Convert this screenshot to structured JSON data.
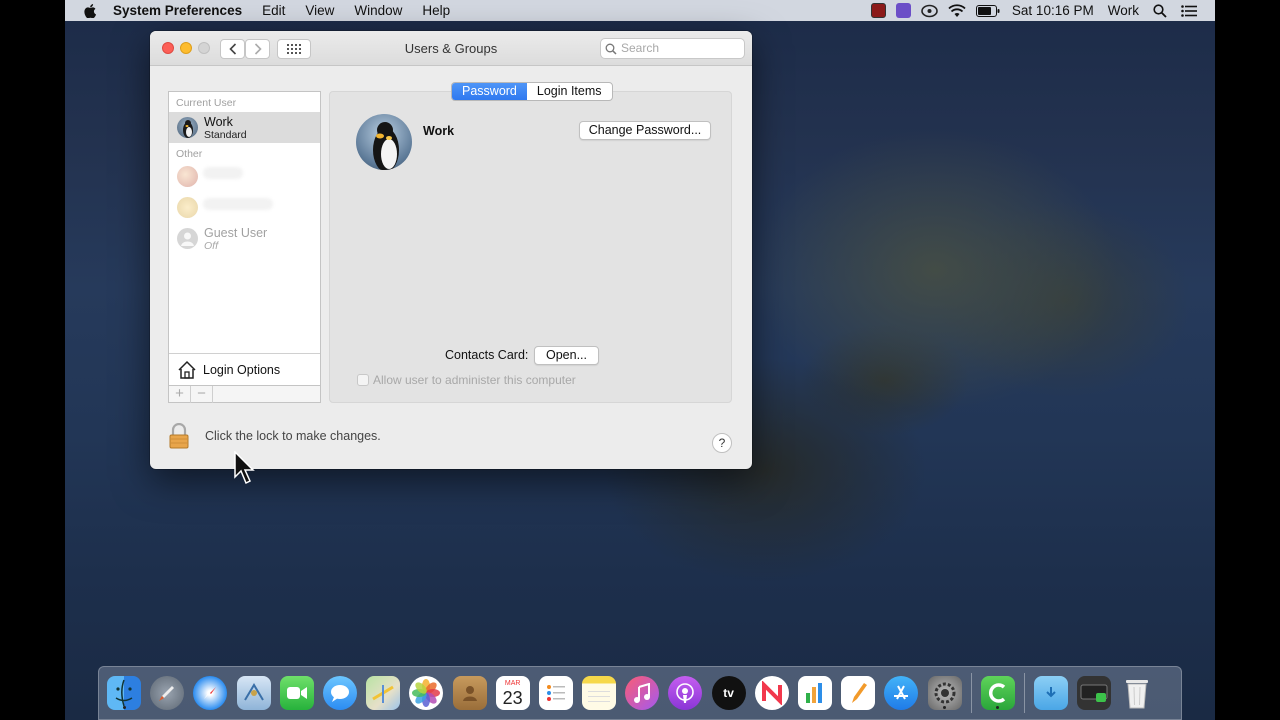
{
  "menubar": {
    "app_name": "System Preferences",
    "items": [
      "Edit",
      "View",
      "Window",
      "Help"
    ],
    "clock": "Sat 10:16 PM",
    "user": "Work"
  },
  "window": {
    "title": "Users & Groups",
    "search_placeholder": "Search"
  },
  "sidebar": {
    "current_user_heading": "Current User",
    "current_user": {
      "name": "Work",
      "role": "Standard"
    },
    "other_heading": "Other",
    "guest": {
      "name": "Guest User",
      "status": "Off"
    },
    "login_options": "Login Options",
    "add_symbol": "+",
    "remove_symbol": "−"
  },
  "tabs": [
    {
      "label": "Password",
      "active": true
    },
    {
      "label": "Login Items",
      "active": false
    }
  ],
  "user_panel": {
    "name": "Work",
    "change_password_label": "Change Password...",
    "contacts_card_label": "Contacts Card:",
    "open_label": "Open...",
    "admin_checkbox_label": "Allow user to administer this computer"
  },
  "lock": {
    "text": "Click the lock to make changes.",
    "help_label": "?"
  },
  "dock": {
    "calendar_month": "MAR",
    "calendar_day": "23",
    "tv_label": "tv",
    "icons": [
      "finder-icon",
      "launchpad-icon",
      "safari-icon",
      "mail-icon",
      "facetime-icon",
      "messages-icon",
      "maps-icon",
      "photos-icon",
      "contacts-icon",
      "calendar-icon",
      "reminders-icon",
      "notes-icon",
      "music-icon",
      "podcasts-icon",
      "tv-icon",
      "news-icon",
      "numbers-icon",
      "pages-icon",
      "app-store-icon",
      "system-preferences-icon",
      "camtasia-icon",
      "downloads-folder-icon",
      "screen-recorder-icon",
      "trash-icon"
    ]
  }
}
